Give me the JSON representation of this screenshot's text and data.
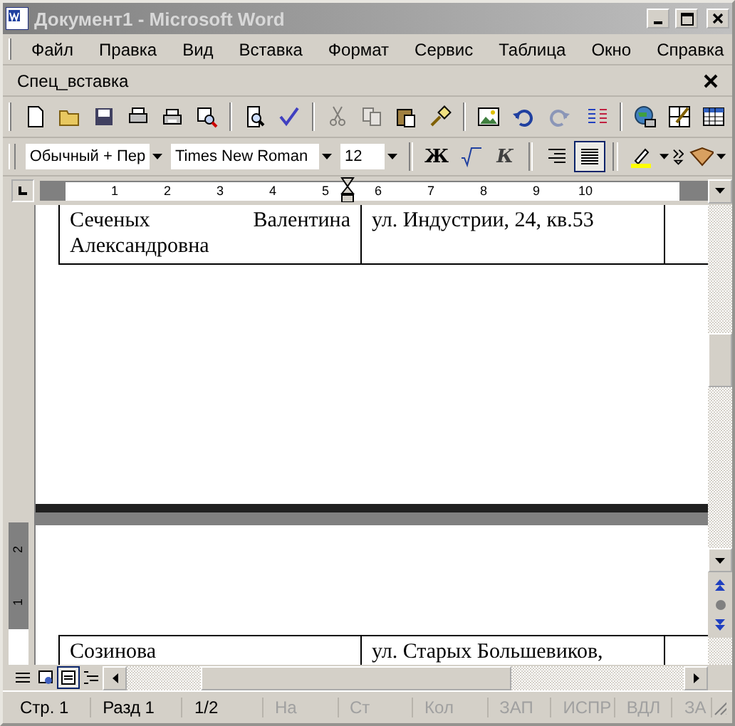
{
  "window": {
    "title": "Документ1 - Microsoft Word"
  },
  "menu": [
    "Файл",
    "Правка",
    "Вид",
    "Вставка",
    "Формат",
    "Сервис",
    "Таблица",
    "Окно",
    "Справка"
  ],
  "task_pane": {
    "title": "Спец_вставка"
  },
  "standard_toolbar": [
    {
      "kind": "new",
      "disabled": false
    },
    {
      "kind": "open",
      "disabled": false
    },
    {
      "kind": "save",
      "disabled": false
    },
    {
      "kind": "permission",
      "disabled": false
    },
    {
      "kind": "print",
      "disabled": false
    },
    {
      "kind": "research",
      "disabled": false
    },
    {
      "kind": "sep"
    },
    {
      "kind": "preview",
      "disabled": false
    },
    {
      "kind": "spelling",
      "disabled": false
    },
    {
      "kind": "sep"
    },
    {
      "kind": "cut",
      "disabled": true
    },
    {
      "kind": "copy",
      "disabled": true
    },
    {
      "kind": "paste",
      "disabled": false
    },
    {
      "kind": "painter",
      "disabled": false
    },
    {
      "kind": "sep"
    },
    {
      "kind": "picture",
      "disabled": false
    },
    {
      "kind": "undo",
      "disabled": false
    },
    {
      "kind": "redo",
      "disabled": true
    },
    {
      "kind": "columns",
      "disabled": false
    },
    {
      "kind": "sep"
    },
    {
      "kind": "web",
      "disabled": false
    },
    {
      "kind": "draw-table",
      "disabled": false
    },
    {
      "kind": "table",
      "disabled": false
    }
  ],
  "formatting_toolbar": {
    "style": "Обычный + Пер",
    "font": "Times New Roman",
    "size": "12",
    "buttons": [
      {
        "kind": "bold",
        "label": "Ж",
        "selected": false
      },
      {
        "kind": "formula",
        "selected": false
      },
      {
        "kind": "italic",
        "label": "К",
        "selected": false
      },
      {
        "kind": "sep"
      },
      {
        "kind": "align-right",
        "selected": false
      },
      {
        "kind": "justify",
        "selected": true
      },
      {
        "kind": "sep"
      },
      {
        "kind": "highlight",
        "selected": false
      }
    ]
  },
  "ruler": {
    "ticks": [
      "1",
      "2",
      "3",
      "4",
      "5",
      "6",
      "7",
      "8",
      "9",
      "10"
    ]
  },
  "vertical_ruler": {
    "ticks": [
      "2",
      "1"
    ]
  },
  "page_1_table": {
    "rows": [
      [
        "Сеченых Валентина Александровна",
        "ул. Индустрии, 24, кв.53",
        ""
      ]
    ]
  },
  "page_2_table": {
    "rows": [
      [
        "Созинова",
        "ул. Старых Большевиков,",
        ""
      ]
    ]
  },
  "views": [
    {
      "kind": "normal",
      "selected": false
    },
    {
      "kind": "web",
      "selected": false
    },
    {
      "kind": "print",
      "selected": true
    },
    {
      "kind": "outline",
      "selected": false
    }
  ],
  "status_bar": [
    {
      "text": "Стр. 1",
      "disabled": false
    },
    {
      "text": "Разд 1",
      "disabled": false
    },
    {
      "text": "1/2",
      "disabled": false
    },
    {
      "text": "На",
      "disabled": true
    },
    {
      "text": "Ст",
      "disabled": true
    },
    {
      "text": "Кол",
      "disabled": true
    },
    {
      "text": "ЗАП",
      "disabled": true
    },
    {
      "text": "ИСПР",
      "disabled": true
    },
    {
      "text": "ВДЛ",
      "disabled": true
    },
    {
      "text": "ЗА",
      "disabled": true
    }
  ]
}
